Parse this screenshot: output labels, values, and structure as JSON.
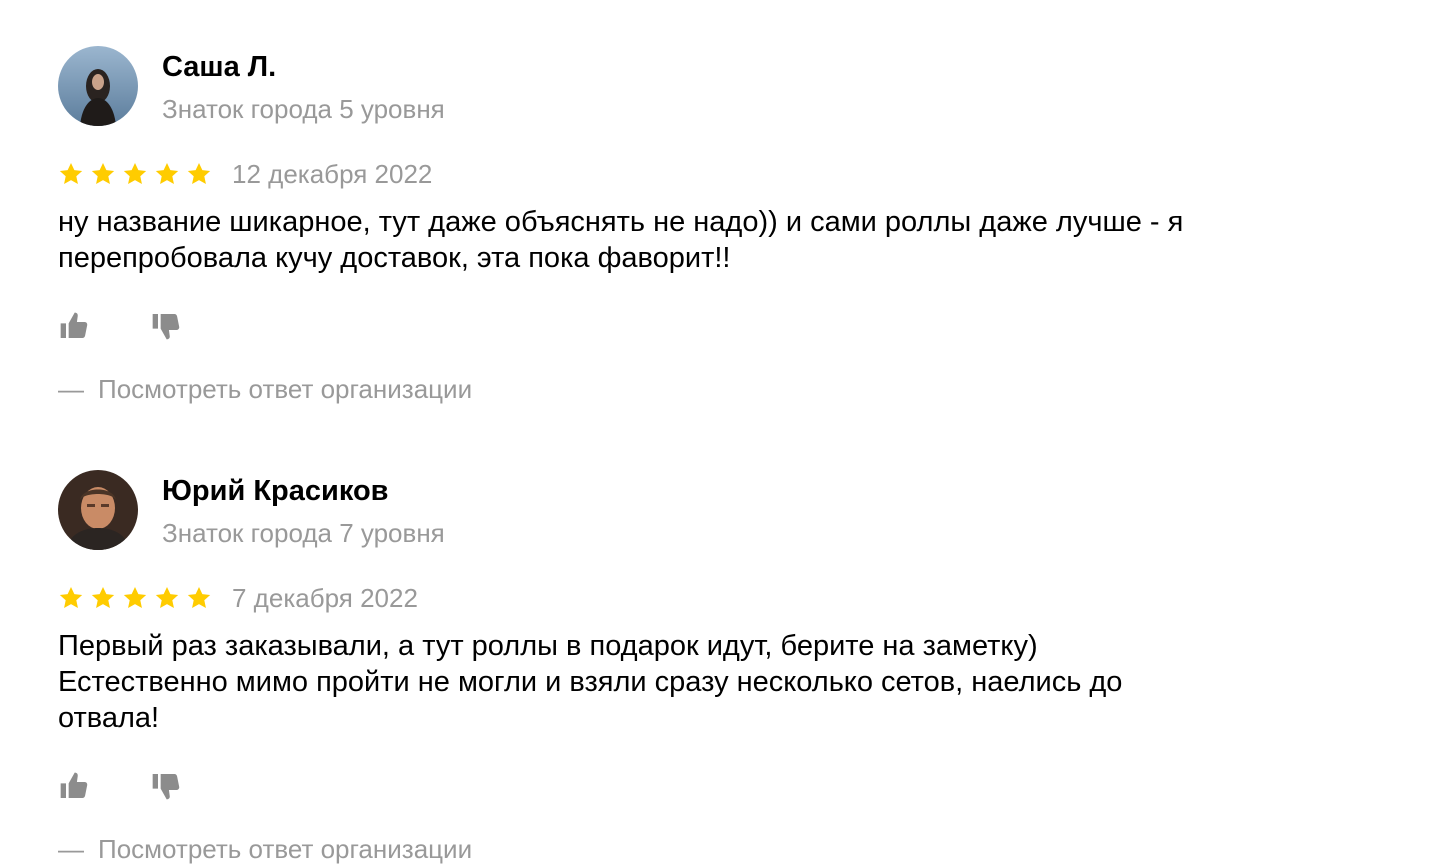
{
  "reviews": [
    {
      "author_name": "Саша Л.",
      "author_level": "Знаток города 5 уровня",
      "rating": 5,
      "date": "12 декабря 2022",
      "text": "ну название шикарное, тут даже объяснять не надо)) и сами роллы даже лучше - я\nперепробовала кучу доставок, эта пока фаворит!!",
      "org_reply_dash": "—",
      "org_reply_label": "Посмотреть ответ организации"
    },
    {
      "author_name": "Юрий Красиков",
      "author_level": "Знаток города 7 уровня",
      "rating": 5,
      "date": "7 декабря 2022",
      "text": "Первый раз заказывали, а тут роллы в подарок идут, берите на заметку)\nЕстественно мимо пройти не могли и взяли сразу несколько сетов, наелись до\nотвала!",
      "org_reply_dash": "—",
      "org_reply_label": "Посмотреть ответ организации"
    }
  ],
  "icons": {
    "star": "star-icon",
    "like": "thumbs-up-icon",
    "dislike": "thumbs-down-icon"
  },
  "colors": {
    "star": "#FFCC00",
    "muted_text": "#999999",
    "icon": "#8C8C8C"
  }
}
